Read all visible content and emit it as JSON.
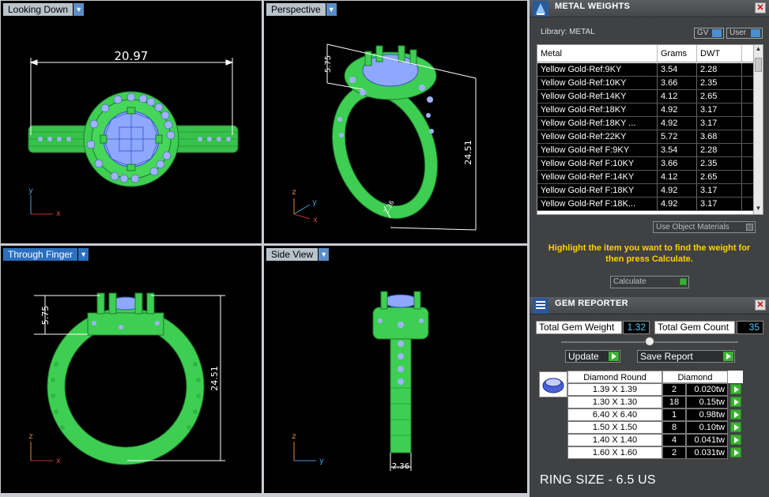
{
  "viewports": {
    "top_left": {
      "label": "Looking Down",
      "dimension": "20.97",
      "axis1": "y",
      "axis2": "x"
    },
    "top_right": {
      "label": "Perspective",
      "dim_height": "5.75",
      "dim_length": "24.51",
      "dim_small": "2.36",
      "axis1": "z",
      "axis2": "y",
      "axis3": "x"
    },
    "bottom_left": {
      "label": "Through Finger",
      "dim_height": "5.75",
      "dim_length": "24.51",
      "axis1": "z",
      "axis2": "x"
    },
    "bottom_right": {
      "label": "Side View",
      "dim_width": "2.36",
      "axis1": "z",
      "axis2": "y"
    }
  },
  "metal_weights": {
    "title": "METAL WEIGHTS",
    "library_label": "Library: METAL",
    "gv_label": "GV",
    "user_label": "User",
    "columns": [
      "Metal",
      "Grams",
      "DWT"
    ],
    "rows": [
      [
        "Yellow Gold-Ref:9KY",
        "3.54",
        "2.28"
      ],
      [
        "Yellow Gold-Ref:10KY",
        "3.66",
        "2.35"
      ],
      [
        "Yellow Gold-Ref:14KY",
        "4.12",
        "2.65"
      ],
      [
        "Yellow Gold-Ref:18KY",
        "4.92",
        "3.17"
      ],
      [
        "Yellow Gold-Ref:18KY ...",
        "4.92",
        "3.17"
      ],
      [
        "Yellow Gold-Ref:22KY",
        "5.72",
        "3.68"
      ],
      [
        "Yellow Gold-Ref F:9KY",
        "3.54",
        "2.28"
      ],
      [
        "Yellow Gold-Ref F:10KY",
        "3.66",
        "2.35"
      ],
      [
        "Yellow Gold-Ref F:14KY",
        "4.12",
        "2.65"
      ],
      [
        "Yellow Gold-Ref F:18KY",
        "4.92",
        "3.17"
      ],
      [
        "Yellow Gold-Ref F:18K...",
        "4.92",
        "3.17"
      ]
    ],
    "use_object_materials": "Use Object Materials",
    "hint": "Highlight the item you want to find the weight for then press Calculate.",
    "calculate_label": "Calculate"
  },
  "gem_reporter": {
    "title": "GEM REPORTER",
    "total_weight_label": "Total Gem Weight",
    "total_weight_value": "1.32",
    "total_count_label": "Total Gem Count",
    "total_count_value": "35",
    "update_label": "Update",
    "save_label": "Save Report",
    "col_shape": "Diamond Round",
    "col_material": "Diamond",
    "rows": [
      [
        "1.39 X 1.39",
        "2",
        "0.020tw"
      ],
      [
        "1.30 X 1.30",
        "18",
        "0.15tw"
      ],
      [
        "6.40 X 6.40",
        "1",
        "0.98tw"
      ],
      [
        "1.50 X 1.50",
        "8",
        "0.10tw"
      ],
      [
        "1.40 X 1.40",
        "4",
        "0.041tw"
      ],
      [
        "1.60 X 1.60",
        "2",
        "0.031tw"
      ]
    ],
    "ring_size": "RING SIZE - 6.5 US"
  },
  "colors": {
    "ring_green": "#3ecf52",
    "gem_blue": "#8fa8ff",
    "viewport_bg": "#000000",
    "accent_yellow": "#ffd200",
    "play_green": "#3cb034"
  }
}
